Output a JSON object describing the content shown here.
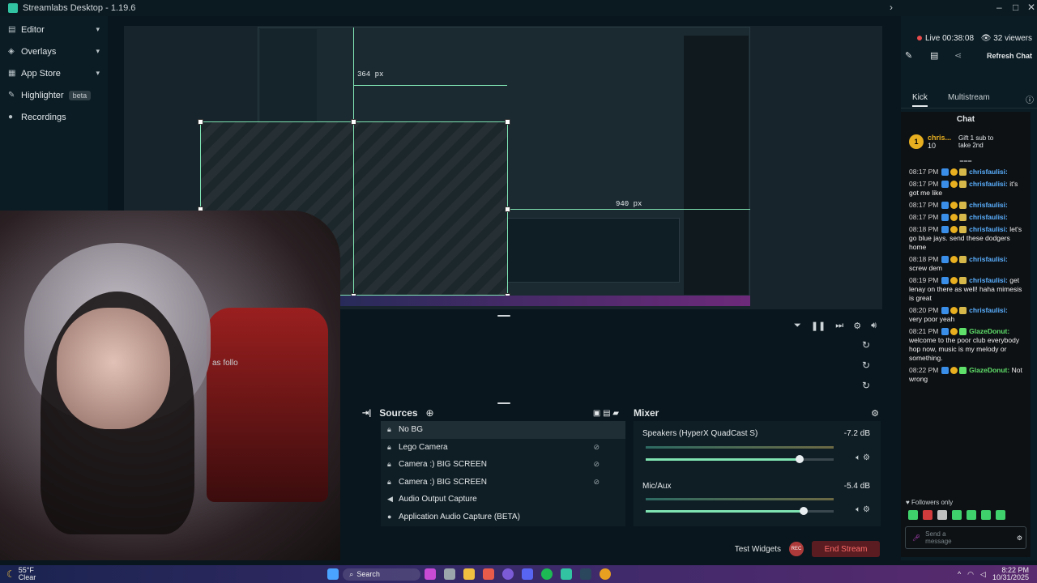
{
  "window": {
    "title": "Streamlabs Desktop - 1.19.6"
  },
  "sidebar": {
    "items": [
      {
        "label": "Editor",
        "icon": "editor-icon",
        "has_chevron": true
      },
      {
        "label": "Overlays",
        "icon": "overlays-icon",
        "has_chevron": true
      },
      {
        "label": "App Store",
        "icon": "app-store-icon",
        "has_chevron": true
      },
      {
        "label": "Highlighter",
        "icon": "highlighter-icon",
        "badge": "beta"
      },
      {
        "label": "Recordings",
        "icon": "recordings-icon"
      }
    ]
  },
  "preview": {
    "measure_top": "364 px",
    "measure_right": "940 px"
  },
  "scenes": {
    "partial_text": "as follo"
  },
  "sources": {
    "title": "Sources",
    "items": [
      {
        "label": "No BG",
        "icon": "lock-icon",
        "selected": true
      },
      {
        "label": "Lego Camera",
        "icon": "lock-icon"
      },
      {
        "label": "Camera :) BIG SCREEN",
        "icon": "lock-icon"
      },
      {
        "label": "Camera :) BIG SCREEN",
        "icon": "lock-icon"
      },
      {
        "label": "Audio Output Capture",
        "icon": "speaker-icon"
      },
      {
        "label": "Application Audio Capture (BETA)",
        "icon": "user-icon"
      }
    ]
  },
  "mixer": {
    "title": "Mixer",
    "channels": [
      {
        "name": "Speakers (HyperX QuadCast S)",
        "db": "-7.2 dB",
        "level": 0.82
      },
      {
        "name": "Mic/Aux",
        "db": "-5.4 dB",
        "level": 0.84
      }
    ]
  },
  "footer": {
    "test_widgets": "Test Widgets",
    "rec": "REC",
    "end_stream": "End Stream"
  },
  "chat": {
    "live_label": "Live 00:38:08",
    "viewers": "32 viewers",
    "refresh": "Refresh Chat",
    "tab_kick": "Kick",
    "tab_multistream": "Multistream",
    "header": "Chat",
    "gift_user": "chris...",
    "gift_count": "10",
    "gift_text": "Gift 1 sub to take 2nd",
    "messages": [
      {
        "time": "08:17 PM",
        "user": "chrisfaulisi:",
        "text": "",
        "green": false
      },
      {
        "time": "08:17 PM",
        "user": "chrisfaulisi:",
        "text": "it's got me like",
        "green": false
      },
      {
        "time": "08:17 PM",
        "user": "chrisfaulisi:",
        "text": "",
        "green": false
      },
      {
        "time": "08:17 PM",
        "user": "chrisfaulisi:",
        "text": "",
        "green": false
      },
      {
        "time": "08:18 PM",
        "user": "chrisfaulisi:",
        "text": "let's go blue jays. send these dodgers home",
        "green": false
      },
      {
        "time": "08:18 PM",
        "user": "chrisfaulisi:",
        "text": "screw dem",
        "green": false
      },
      {
        "time": "08:19 PM",
        "user": "chrisfaulisi:",
        "text": "get lenay on there as well! haha mimesis is great",
        "green": false
      },
      {
        "time": "08:20 PM",
        "user": "chrisfaulisi:",
        "text": "very poor yeah",
        "green": false
      },
      {
        "time": "08:21 PM",
        "user": "GlazeDonut:",
        "text": "welcome to the poor club everybody hop now, music is my melody or something.",
        "green": true
      },
      {
        "time": "08:22 PM",
        "user": "GlazeDonut:",
        "text": "Not wrong",
        "green": true
      }
    ],
    "followers_only": "Followers only",
    "send_placeholder": "Send a message"
  },
  "taskbar": {
    "weather_temp": "55°F",
    "weather_desc": "Clear",
    "search": "Search",
    "time": "8:22 PM",
    "date": "10/31/2025"
  }
}
